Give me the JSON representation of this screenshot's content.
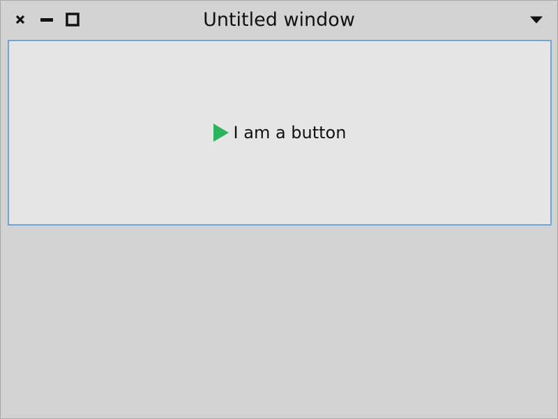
{
  "window": {
    "title": "Untitled window",
    "controls": {
      "close_icon": "close-icon",
      "minimize_icon": "minimize-icon",
      "maximize_icon": "maximize-icon",
      "menu_icon": "chevron-down-icon"
    }
  },
  "content": {
    "button": {
      "label": "I am a button",
      "icon": "play-icon",
      "icon_color": "#2db35d"
    }
  },
  "colors": {
    "background": "#d3d3d3",
    "button_background": "#e6e6e6",
    "button_border": "#6ea6dc"
  }
}
